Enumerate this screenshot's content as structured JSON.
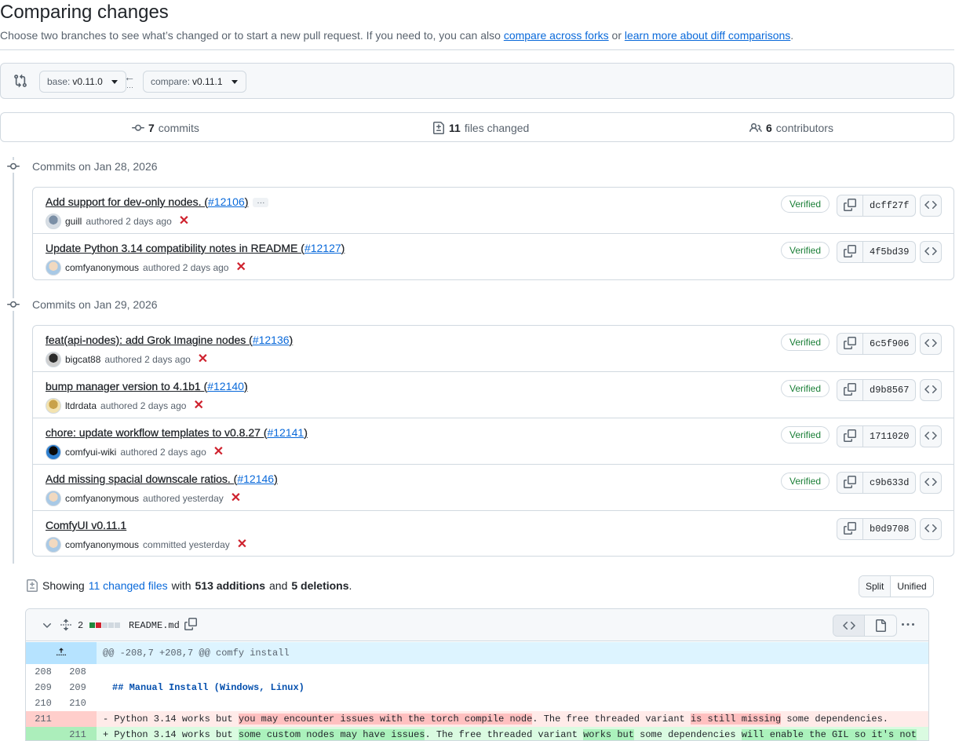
{
  "header": {
    "title": "Comparing changes",
    "subtitle_prefix": "Choose two branches to see what’s changed or to start a new pull request. If you need to, you can also ",
    "link_forks": "compare across forks",
    "subtitle_mid": " or ",
    "link_learn": "learn more about diff comparisons",
    "subtitle_end": "."
  },
  "range": {
    "base_label": "base:",
    "base_value": "v0.11.0",
    "compare_label": "compare:",
    "compare_value": "v0.11.1",
    "arrow": "←",
    "dots": "···"
  },
  "summary": {
    "commits_count": "7",
    "commits_label": "commits",
    "files_count": "11",
    "files_label": "files changed",
    "contributors_count": "6",
    "contributors_label": "contributors"
  },
  "groups": [
    {
      "label": "Commits on Jan 28, 2026",
      "commits": [
        {
          "title": "Add support for dev-only nodes. (",
          "pr": "#12106",
          "close": ")",
          "author": "guill",
          "action": "authored 2 days ago",
          "verified": "Verified",
          "sha": "dcff27f"
        },
        {
          "title": "Update Python 3.14 compatibility notes in README (",
          "pr": "#12127",
          "close": ")",
          "author": "comfyanonymous",
          "action": "authored 2 days ago",
          "verified": "Verified",
          "sha": "4f5bd39"
        }
      ]
    },
    {
      "label": "Commits on Jan 29, 2026",
      "commits": [
        {
          "title": "feat(api-nodes): add Grok Imagine nodes (",
          "pr": "#12136",
          "close": ")",
          "author": "bigcat88",
          "action": "authored 2 days ago",
          "verified": "Verified",
          "sha": "6c5f906"
        },
        {
          "title": "bump manager version to 4.1b1 (",
          "pr": "#12140",
          "close": ")",
          "author": "ltdrdata",
          "action": "authored 2 days ago",
          "verified": "Verified",
          "sha": "d9b8567"
        },
        {
          "title": "chore: update workflow templates to v0.8.27 (",
          "pr": "#12141",
          "close": ")",
          "author": "comfyui-wiki",
          "action": "authored 2 days ago",
          "verified": "Verified",
          "sha": "1711020"
        },
        {
          "title": "Add missing spacial downscale ratios. (",
          "pr": "#12146",
          "close": ")",
          "author": "comfyanonymous",
          "action": "authored yesterday",
          "verified": "Verified",
          "sha": "c9b633d"
        },
        {
          "title": "ComfyUI v0.11.1",
          "pr": "",
          "close": "",
          "author": "comfyanonymous",
          "action": "committed yesterday",
          "verified": "",
          "sha": "b0d9708"
        }
      ]
    }
  ],
  "files_summary": {
    "prefix": "Showing",
    "changed_link": "11 changed files",
    "with": "with",
    "additions": "513 additions",
    "and": "and",
    "deletions": "5 deletions",
    "end": "."
  },
  "view_toggle": {
    "split": "Split",
    "unified": "Unified"
  },
  "file": {
    "changes": "2",
    "name": "README.md",
    "hunk": "@@ -208,7 +208,7 @@ comfy install",
    "lines": [
      {
        "old": "208",
        "new": "208",
        "text": ""
      },
      {
        "old": "209",
        "new": "209",
        "text": "## Manual Install (Windows, Linux)"
      },
      {
        "old": "210",
        "new": "210",
        "text": ""
      }
    ],
    "del_line": {
      "old": "211",
      "p1": "- Python 3.14 works but ",
      "h1": "you may encounter issues with the torch compile node",
      "p2": ". The free threaded variant ",
      "h2": "is still missing",
      "p3": " some dependencies."
    },
    "add_line": {
      "new": "211",
      "p1": "+ Python 3.14 works but ",
      "h1": "some custom nodes may have issues",
      "p2": ". The free threaded variant ",
      "h2": "works but",
      "p3": " some dependencies ",
      "h3": "will enable the GIL so it's not"
    }
  }
}
